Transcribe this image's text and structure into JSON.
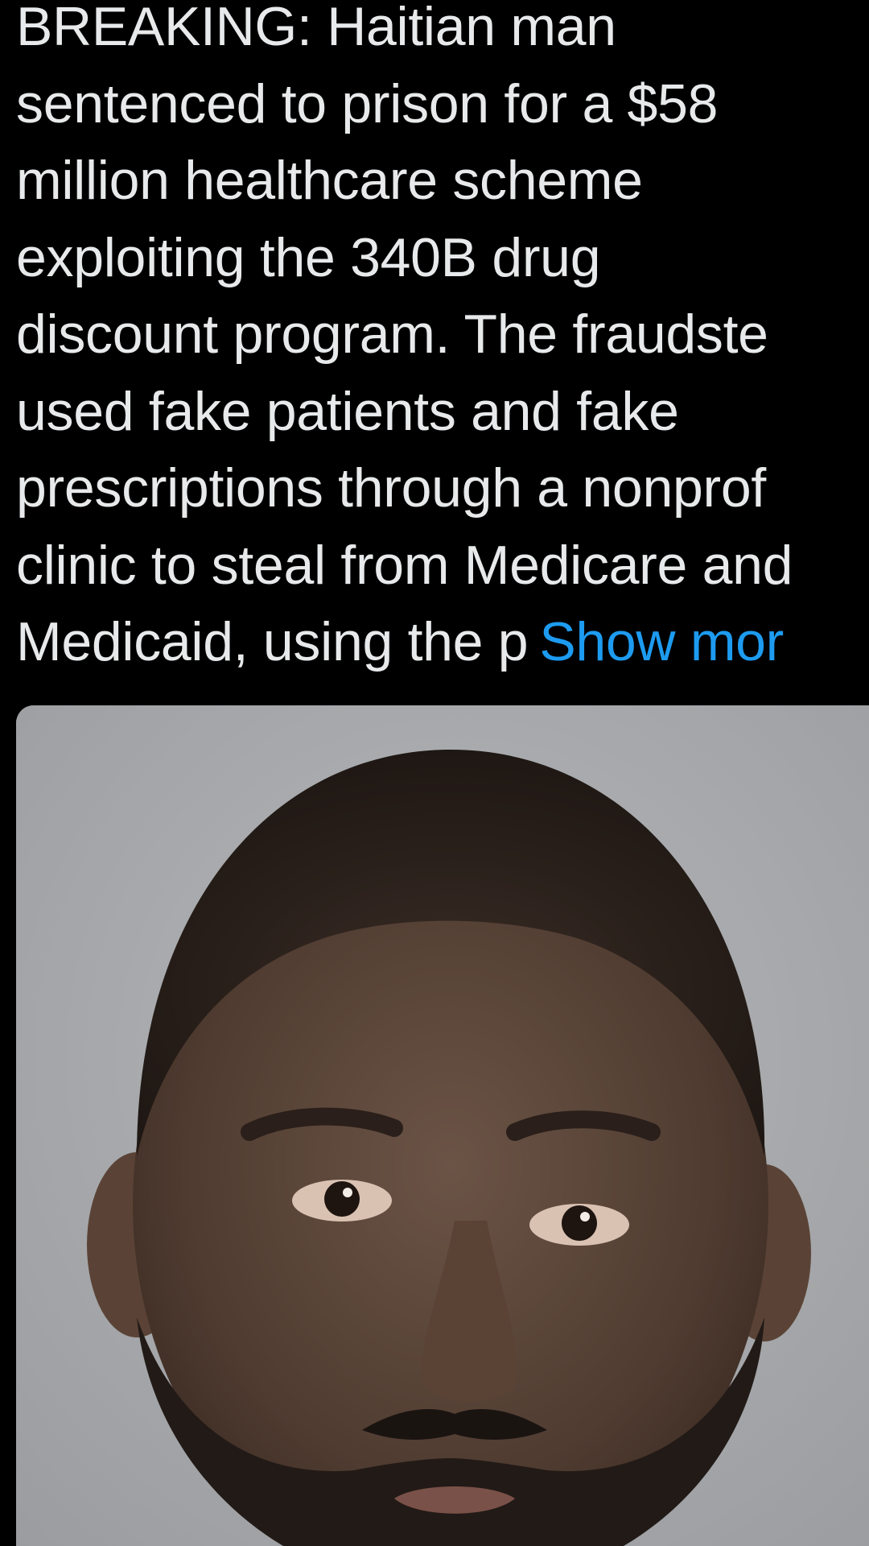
{
  "post": {
    "text_lines": [
      "BREAKING: Haitian man",
      "sentenced to prison for a $58",
      "million healthcare scheme",
      "exploiting the 340B drug",
      "discount program. The fraudste",
      "used fake patients and fake",
      "prescriptions through a nonprof",
      "clinic to steal from Medicare and",
      "Medicaid, using the p"
    ],
    "show_more_label": "Show mor",
    "media": {
      "alt": "mugshot photo"
    }
  },
  "colors": {
    "background": "#000000",
    "text": "#e7e9ea",
    "link": "#1d9bf0",
    "photo_backdrop": "#a6a8ab"
  }
}
